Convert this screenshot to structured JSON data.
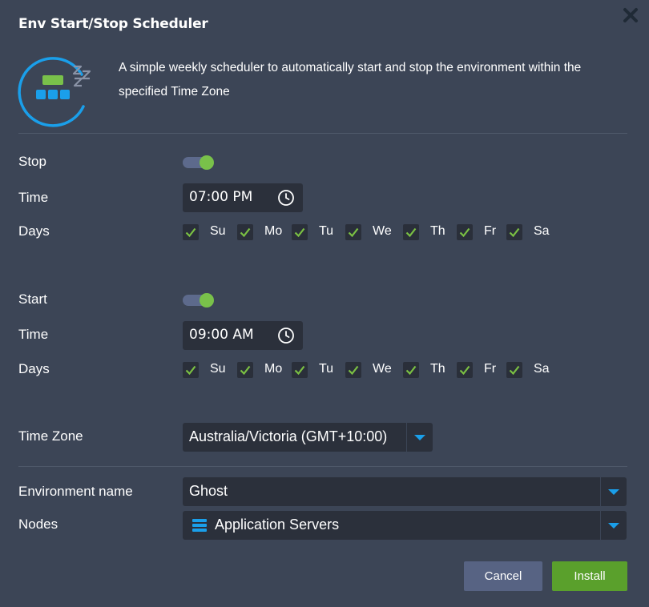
{
  "dialog": {
    "title": "Env Start/Stop Scheduler",
    "close_icon": "close-icon",
    "logo_icon": "sleeping-server-icon",
    "description": "A simple weekly scheduler to automatically start and stop the environment within the specified Time Zone"
  },
  "stop": {
    "label": "Stop",
    "enabled": true,
    "time_label": "Time",
    "time_value": "07:00 PM",
    "days_label": "Days",
    "days": [
      {
        "label": "Su",
        "checked": true
      },
      {
        "label": "Mo",
        "checked": true
      },
      {
        "label": "Tu",
        "checked": true
      },
      {
        "label": "We",
        "checked": true
      },
      {
        "label": "Th",
        "checked": true
      },
      {
        "label": "Fr",
        "checked": true
      },
      {
        "label": "Sa",
        "checked": true
      }
    ]
  },
  "start": {
    "label": "Start",
    "enabled": true,
    "time_label": "Time",
    "time_value": "09:00 AM",
    "days_label": "Days",
    "days": [
      {
        "label": "Su",
        "checked": true
      },
      {
        "label": "Mo",
        "checked": true
      },
      {
        "label": "Tu",
        "checked": true
      },
      {
        "label": "We",
        "checked": true
      },
      {
        "label": "Th",
        "checked": true
      },
      {
        "label": "Fr",
        "checked": true
      },
      {
        "label": "Sa",
        "checked": true
      }
    ]
  },
  "timezone": {
    "label": "Time Zone",
    "value": "Australia/Victoria (GMT+10:00)"
  },
  "environment": {
    "label": "Environment name",
    "value": "Ghost"
  },
  "nodes": {
    "label": "Nodes",
    "value": "Application Servers",
    "icon": "server-stack-icon"
  },
  "buttons": {
    "cancel": "Cancel",
    "install": "Install"
  },
  "colors": {
    "background": "#3c4556",
    "input_bg": "#2b303b",
    "accent_blue": "#1a9fea",
    "toggle_on": "#79c14a",
    "check_green": "#7bc143",
    "install_green": "#5aa02c",
    "cancel_bg": "#576383"
  }
}
